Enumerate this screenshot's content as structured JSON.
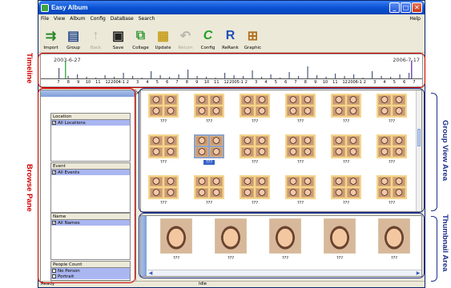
{
  "annotations": {
    "timeline": "Timeline",
    "browse_pane": "Browse Pane",
    "group_view": "Group View Area",
    "thumbnail": "Thumbnail Area"
  },
  "window": {
    "title": "Easy Album"
  },
  "menu": {
    "items": [
      "File",
      "View",
      "Album",
      "Config",
      "DataBase",
      "Search"
    ],
    "help": "Help"
  },
  "toolbar": {
    "import": "Import",
    "group": "Group",
    "back": "Back",
    "save": "Save",
    "collage": "Collage",
    "update": "Update",
    "return": "Return",
    "config": "Config",
    "rerank": "ReRank",
    "graphic": "Graphic"
  },
  "timeline": {
    "start_date": "2003-6-27",
    "end_date": "2006-7-17",
    "ticks": [
      "7",
      "8",
      "9",
      "10",
      "11",
      "12",
      "2004-1",
      "2",
      "3",
      "4",
      "5",
      "6",
      "7",
      "8",
      "9",
      "10",
      "11",
      "12",
      "2005-1",
      "2",
      "3",
      "4",
      "5",
      "6",
      "7",
      "8",
      "9",
      "10",
      "11",
      "12",
      "2006-1",
      "2",
      "3",
      "4",
      "5",
      "6",
      "7"
    ]
  },
  "browse": {
    "location": {
      "header": "Location",
      "items": [
        {
          "label": "All Locations",
          "checked": true
        }
      ]
    },
    "event": {
      "header": "Event",
      "items": [
        {
          "label": "All Events",
          "checked": true
        }
      ]
    },
    "name": {
      "header": "Name",
      "items": [
        {
          "label": "All Names",
          "checked": true
        }
      ]
    },
    "people_count": {
      "header": "People Count",
      "items": [
        {
          "label": "No Person",
          "checked": false
        },
        {
          "label": "Portrait",
          "checked": false
        }
      ]
    }
  },
  "group_labels": [
    "???",
    "???",
    "???",
    "???",
    "???",
    "???",
    "???",
    "???",
    "???",
    "???",
    "???",
    "???",
    "???",
    "???",
    "???",
    "???",
    "???",
    "???"
  ],
  "thumb_labels": [
    "???",
    "???",
    "???",
    "???",
    "???"
  ],
  "status": {
    "left": "Ready",
    "middle": "Idle"
  },
  "colors": {
    "annotation_red": "#d00000",
    "annotation_blue": "#1d2f8c",
    "titlebar": "#0a53d4"
  }
}
